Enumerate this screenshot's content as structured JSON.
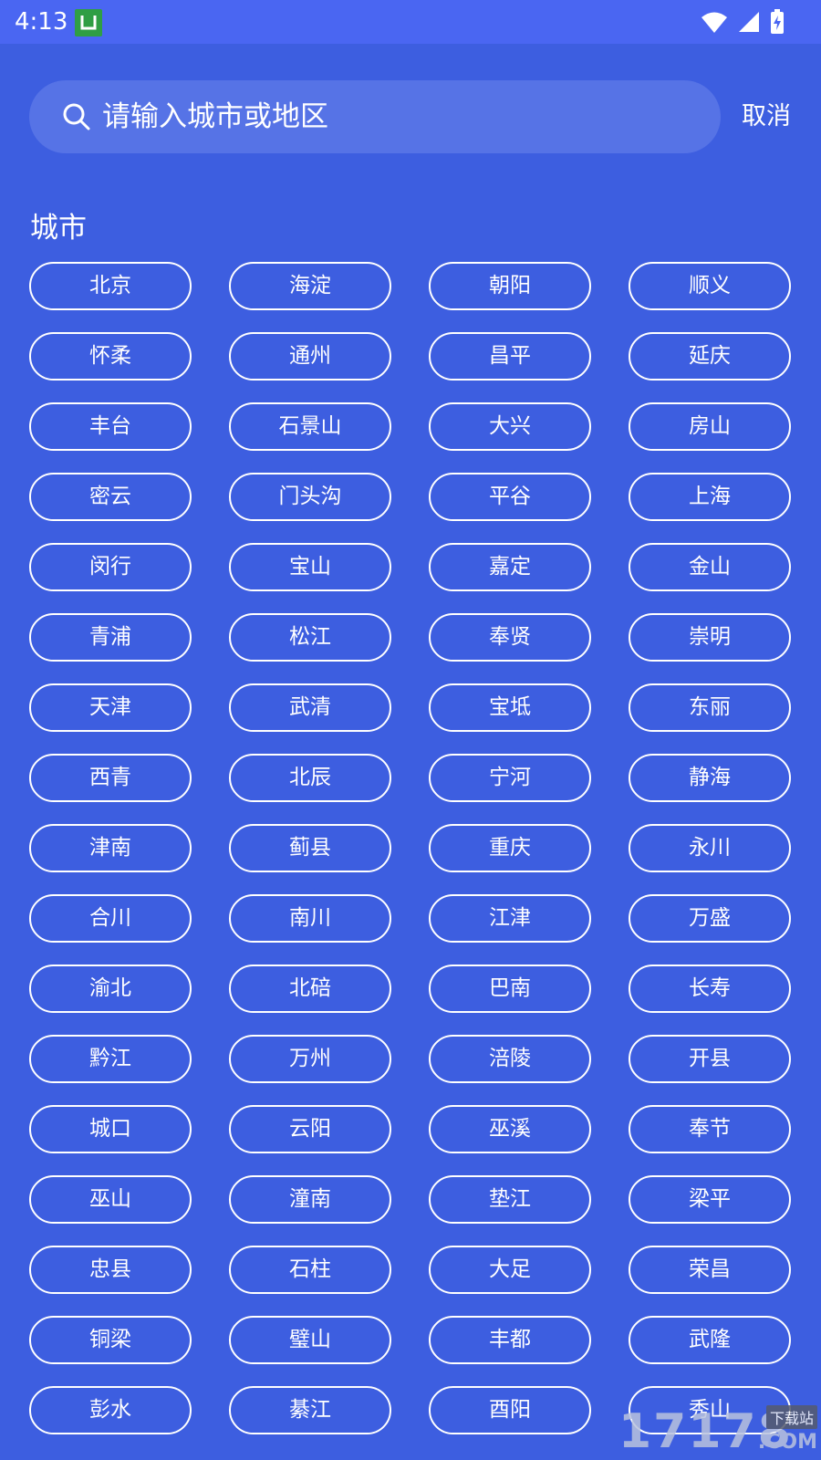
{
  "status_bar": {
    "time": "4:13",
    "app_icon_letter": "U"
  },
  "search": {
    "placeholder": "请输入城市或地区",
    "value": "",
    "cancel_label": "取消"
  },
  "section": {
    "title": "城市"
  },
  "cities": [
    "北京",
    "海淀",
    "朝阳",
    "顺义",
    "怀柔",
    "通州",
    "昌平",
    "延庆",
    "丰台",
    "石景山",
    "大兴",
    "房山",
    "密云",
    "门头沟",
    "平谷",
    "上海",
    "闵行",
    "宝山",
    "嘉定",
    "金山",
    "青浦",
    "松江",
    "奉贤",
    "崇明",
    "天津",
    "武清",
    "宝坻",
    "东丽",
    "西青",
    "北辰",
    "宁河",
    "静海",
    "津南",
    "蓟县",
    "重庆",
    "永川",
    "合川",
    "南川",
    "江津",
    "万盛",
    "渝北",
    "北碚",
    "巴南",
    "长寿",
    "黔江",
    "万州",
    "涪陵",
    "开县",
    "城口",
    "云阳",
    "巫溪",
    "奉节",
    "巫山",
    "潼南",
    "垫江",
    "梁平",
    "忠县",
    "石柱",
    "大足",
    "荣昌",
    "铜梁",
    "璧山",
    "丰都",
    "武隆",
    "彭水",
    "綦江",
    "酉阳",
    "秀山"
  ],
  "watermark": {
    "main": "17178",
    "sub": "下载站",
    "com": ".COM"
  },
  "colors": {
    "background": "#3d5ee0",
    "status_bar": "#4a66f2",
    "search_bg": "#5673e6",
    "chip_border": "#ffffff"
  }
}
